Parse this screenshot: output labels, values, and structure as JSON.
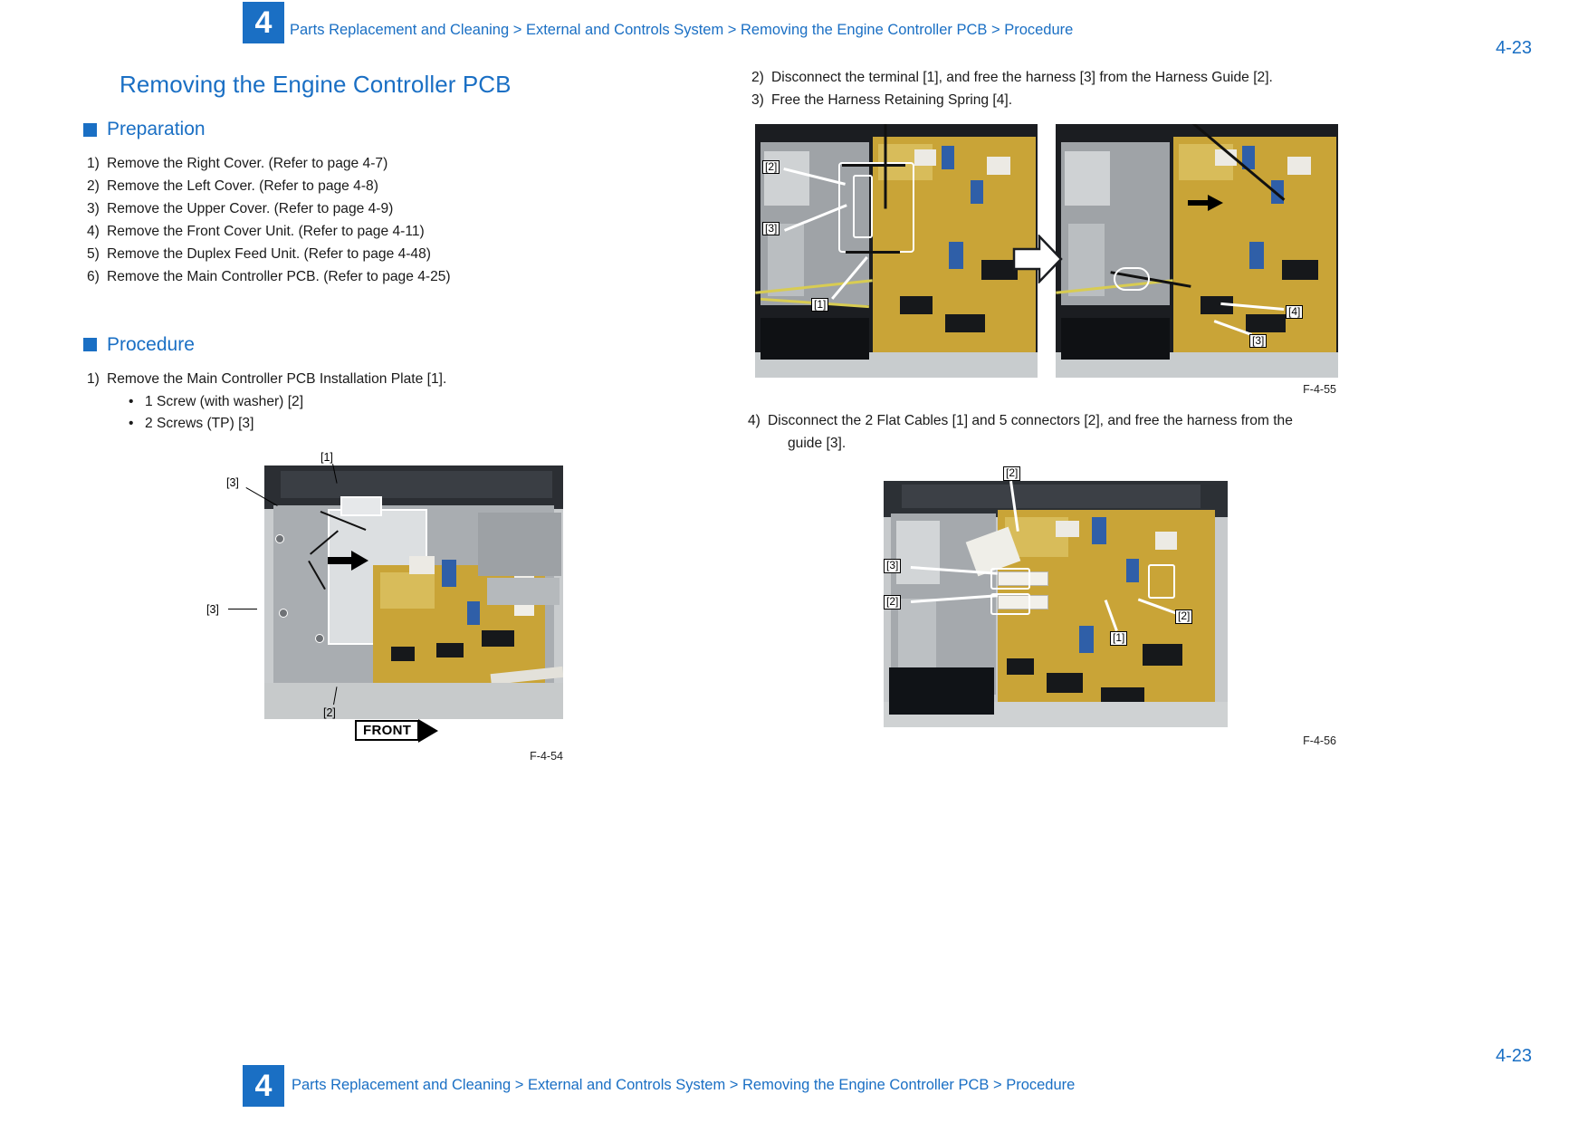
{
  "header": {
    "chapter": "4",
    "breadcrumb": "Parts Replacement and Cleaning > External and Controls System > Removing the Engine Controller PCB > Procedure",
    "page_number": "4-23"
  },
  "footer": {
    "chapter": "4",
    "breadcrumb": "Parts Replacement and Cleaning > External and Controls System > Removing the Engine Controller PCB > Procedure",
    "page_number": "4-23"
  },
  "title": "Removing the Engine Controller PCB",
  "preparation": {
    "heading": "Preparation",
    "steps": [
      {
        "n": "1)",
        "text": "Remove the Right Cover. (Refer to page 4-7)"
      },
      {
        "n": "2)",
        "text": "Remove the Left Cover. (Refer to page 4-8)"
      },
      {
        "n": "3)",
        "text": "Remove the Upper Cover. (Refer to page 4-9)"
      },
      {
        "n": "4)",
        "text": "Remove the Front Cover Unit. (Refer to page 4-11)"
      },
      {
        "n": "5)",
        "text": "Remove the Duplex Feed Unit. (Refer to page 4-48)"
      },
      {
        "n": "6)",
        "text": "Remove the Main Controller PCB. (Refer to page 4-25)"
      }
    ]
  },
  "procedure": {
    "heading": "Procedure",
    "step1": {
      "n": "1)",
      "text": "Remove the Main Controller PCB Installation Plate [1]."
    },
    "bullets": [
      {
        "dot": "•",
        "text": "1 Screw (with washer) [2]"
      },
      {
        "dot": "•",
        "text": "2 Screws (TP) [3]"
      }
    ]
  },
  "right_steps": {
    "step2": {
      "n": "2)",
      "text": "Disconnect the terminal [1], and free the harness [3] from the Harness Guide [2]."
    },
    "step3": {
      "n": "3)",
      "text": "Free the Harness Retaining Spring [4]."
    },
    "step4": {
      "n": "4)",
      "line1": "Disconnect the 2 Flat Cables [1] and 5 connectors [2], and free the harness from the",
      "line2": "guide [3]."
    }
  },
  "figures": {
    "f54": {
      "caption": "F-4-54",
      "front_label": "FRONT",
      "callouts": [
        "[1]",
        "[3]",
        "[3]",
        "[2]"
      ]
    },
    "f55": {
      "caption": "F-4-55",
      "callouts_left": [
        "[2]",
        "[3]",
        "[1]"
      ],
      "callouts_right": [
        "[4]",
        "[3]"
      ]
    },
    "f56": {
      "caption": "F-4-56",
      "callouts": [
        "[2]",
        "[3]",
        "[2]",
        "[1]",
        "[2]"
      ]
    }
  },
  "colors": {
    "accent": "#1a6fc4",
    "text": "#1a1a1a",
    "pcb": "#c9a437"
  }
}
